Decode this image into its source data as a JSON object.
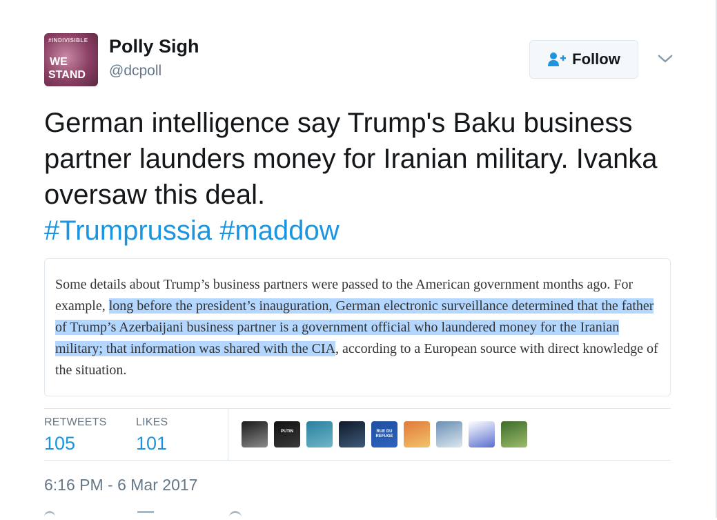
{
  "author": {
    "name": "Polly Sigh",
    "handle": "@dcpoll",
    "avatar": {
      "top_text": "#INDIVISIBLE",
      "line1": "WE",
      "line2": "STAND"
    }
  },
  "follow_button": {
    "label": "Follow",
    "icon": "person-add-icon"
  },
  "tweet": {
    "text_main": "German intelligence say Trump's Baku business partner launders money for Iranian military. Ivanka oversaw this deal.",
    "hashtags": [
      "#Trumprussia",
      "#maddow"
    ]
  },
  "quote_image": {
    "before": "Some details about Trump’s business partners were passed to the American government months ago. For example, ",
    "highlighted": "long before the president’s inauguration, German electronic surveillance determined that the father of Trump’s Azerbaijani business partner is a government official who laundered money for the Iranian military; that information was shared with the CIA",
    "after": ", according to a European source with direct knowledge of the situation."
  },
  "stats": {
    "retweets_label": "RETWEETS",
    "retweets": "105",
    "likes_label": "LIKES",
    "likes": "101"
  },
  "likers": [
    {
      "name": "liker-avatar-1",
      "colors": [
        "#1a1a1a",
        "#8c8c8c"
      ]
    },
    {
      "name": "liker-avatar-2",
      "colors": [
        "#111111",
        "#3a3a3a"
      ],
      "text": "PUTIN"
    },
    {
      "name": "liker-avatar-3",
      "colors": [
        "#2a7f9e",
        "#6fb6c9"
      ]
    },
    {
      "name": "liker-avatar-4",
      "colors": [
        "#0e1a2a",
        "#3f5a7a"
      ]
    },
    {
      "name": "liker-avatar-5",
      "colors": [
        "#1f4fa0",
        "#2e63bf"
      ],
      "text": "RUE DU REFUGE"
    },
    {
      "name": "liker-avatar-6",
      "colors": [
        "#e07a3a",
        "#f3c36a"
      ]
    },
    {
      "name": "liker-avatar-7",
      "colors": [
        "#6a8fb5",
        "#dde7ee"
      ]
    },
    {
      "name": "liker-avatar-8",
      "colors": [
        "#ffffff",
        "#5a6fd0"
      ]
    },
    {
      "name": "liker-avatar-9",
      "colors": [
        "#3d6b2a",
        "#9cbc6a"
      ]
    }
  ],
  "timestamp": "6:16 PM - 6 Mar 2017",
  "colors": {
    "link": "#1b95e0",
    "muted": "#657786",
    "border": "#e1e8ed",
    "highlight": "#b3d7ff"
  }
}
